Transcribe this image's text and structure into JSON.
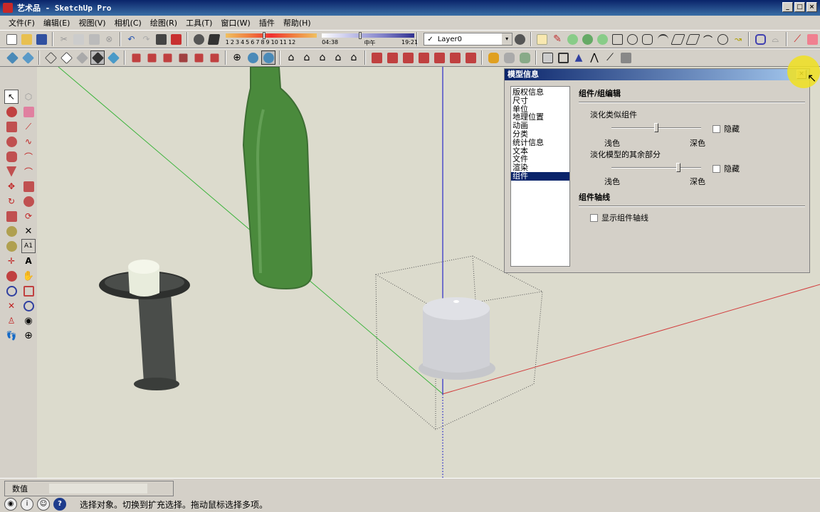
{
  "window": {
    "title": "艺术品 - SketchUp Pro",
    "min": "_",
    "max": "□",
    "close": "×"
  },
  "menu": [
    "文件(F)",
    "编辑(E)",
    "视图(V)",
    "相机(C)",
    "绘图(R)",
    "工具(T)",
    "窗口(W)",
    "插件",
    "帮助(H)"
  ],
  "shadow": {
    "months": [
      "1",
      "2",
      "3",
      "4",
      "5",
      "6",
      "7",
      "8",
      "9",
      "10",
      "11",
      "12"
    ],
    "time_start": "04:38",
    "time_mid": "中午",
    "time_end": "19:21"
  },
  "layer": {
    "name": "Layer0",
    "check": "✓",
    "dropdown": "▾"
  },
  "dialog": {
    "title": "模型信息",
    "close": "×",
    "list": [
      "版权信息",
      "尺寸",
      "单位",
      "地理位置",
      "动画",
      "分类",
      "统计信息",
      "文本",
      "文件",
      "渲染",
      "组件"
    ],
    "selected": "组件",
    "section1": "组件/组编辑",
    "fade_similar": "淡化类似组件",
    "fade_rest": "淡化模型的其余部分",
    "hide": "隐藏",
    "light": "浅色",
    "dark": "深色",
    "section2": "组件轴线",
    "show_axes": "显示组件轴线",
    "fade_similar_level": 0.5,
    "fade_rest_level": 0.76
  },
  "measure": {
    "label": "数值",
    "value": ""
  },
  "status": {
    "text": "选择对象。切换到扩充选择。拖动鼠标选择多项。",
    "help": "?"
  },
  "colors": {
    "axis_red": "#d23c3c",
    "axis_green": "#3cb43c",
    "axis_blue": "#2828c8",
    "bottle": "#4a8a3c",
    "ground": "#dcdbcd"
  }
}
